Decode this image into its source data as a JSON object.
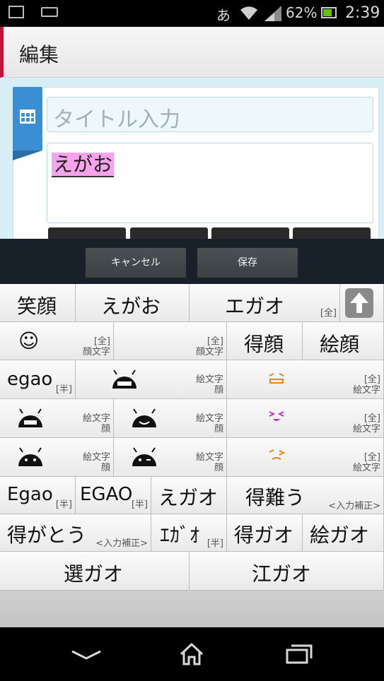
{
  "status_bar": {
    "ime_indicator": "あ",
    "battery": "62%",
    "time": "2:39"
  },
  "header": {
    "title": "編集"
  },
  "editor": {
    "title_placeholder": "タイトル入力",
    "composing_text": "えがお",
    "category_icon": "grid-icon"
  },
  "action_bar": {
    "cancel_label": "キャンセル",
    "save_label": "保存"
  },
  "candidates": {
    "row1": [
      {
        "text": "笑顔"
      },
      {
        "text": "えがお"
      },
      {
        "text": "エガオ",
        "note": "[全]"
      }
    ],
    "row2": [
      {
        "text": "☺",
        "note": "[全]",
        "note2": "顔文字"
      },
      {
        "text": "",
        "note": "[全]",
        "note2": "顔文字"
      },
      {
        "text": "得顔"
      },
      {
        "text": "絵顔"
      }
    ],
    "row3": [
      {
        "text": "egao",
        "note": "[半]"
      },
      {
        "note": "絵文字",
        "note2": "顔"
      },
      {
        "note": "[全]",
        "note2": "絵文字"
      }
    ],
    "row4": [
      {
        "note": "絵文字",
        "note2": "顔"
      },
      {
        "note": "絵文字",
        "note2": "顔"
      },
      {
        "note": "[全]",
        "note2": "絵文字"
      }
    ],
    "row5": [
      {
        "note": "絵文字",
        "note2": "顔"
      },
      {
        "note": "絵文字",
        "note2": "顔"
      },
      {
        "note": "[全]",
        "note2": "絵文字"
      }
    ],
    "row6": [
      {
        "text": "Egao",
        "note": "[半]"
      },
      {
        "text": "EGAO",
        "note": "[半]"
      },
      {
        "text": "えガオ"
      },
      {
        "text": "得難う",
        "note": "<入力補正>"
      }
    ],
    "row7": [
      {
        "text": "得がとう",
        "note": "<入力補正>"
      },
      {
        "text": "ｴｶﾞｵ",
        "note": "[半]"
      },
      {
        "text": "得ガオ"
      },
      {
        "text": "絵ガオ"
      }
    ],
    "row8": [
      {
        "text": "選ガオ"
      },
      {
        "text": "江ガオ"
      }
    ],
    "emoji_colors": {
      "android": "#111111",
      "orange_face": "#e08a1a",
      "pink_face": "#c03ab8"
    }
  }
}
